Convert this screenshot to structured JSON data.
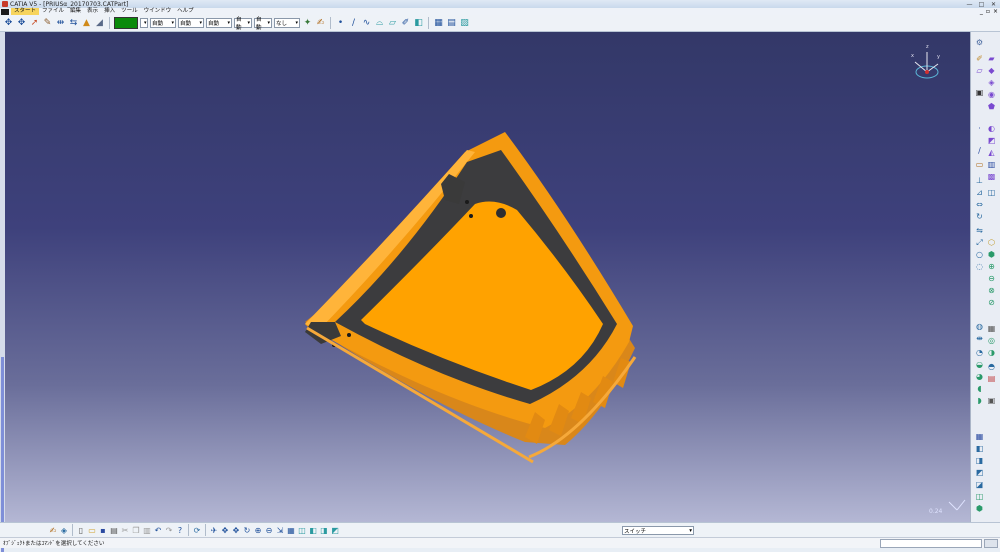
{
  "window": {
    "title": "CATIA V5 - [PRIUSα_20170703.CATPart]",
    "controls": [
      "—",
      "□",
      "✕"
    ]
  },
  "menu": {
    "items": [
      "スタート",
      "ファイル",
      "編集",
      "表示",
      "挿入",
      "ツール",
      "ウインドウ",
      "ヘルプ"
    ],
    "mdi_controls": [
      "_",
      "▫",
      "×"
    ]
  },
  "toolbar_top": {
    "color_swatch": "#0a8a0a",
    "selects": [
      "自動",
      "自動",
      "自動",
      "自動",
      "自動",
      "なし"
    ]
  },
  "command_input": {
    "value": "スイッチ"
  },
  "viewport": {
    "scale_text": "0.24",
    "part_color": "#ffa200",
    "gasket_color": "#3c3c3e"
  },
  "status": {
    "message": "ｵﾌﾞｼﾞｪｸﾄまたはｺﾏﾝﾄﾞを選択してください"
  }
}
